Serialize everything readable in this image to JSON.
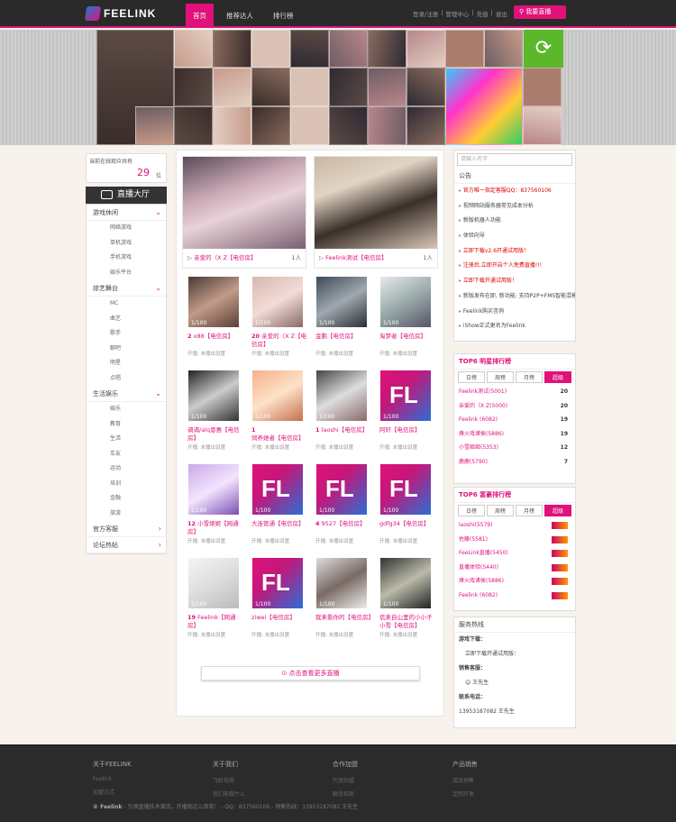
{
  "header": {
    "logo_text": "FEELINK",
    "nav": [
      "首页",
      "推荐达人",
      "排行榜"
    ],
    "top_links": [
      "登录/注册",
      "|",
      "管理中心",
      "|",
      "充值",
      "|",
      "退出"
    ],
    "live_button": "我要直播"
  },
  "sidebar": {
    "online_label": "当前在线观众共有",
    "online_count": "29",
    "online_unit": "位",
    "hall_label": "直播大厅",
    "categories": [
      {
        "label": "游戏休闲",
        "items": [
          "网络游戏",
          "单机游戏",
          "手机游戏",
          "娱乐平台"
        ]
      },
      {
        "label": "综艺舞台",
        "items": [
          "MC",
          "曲艺",
          "歌手",
          "聊吧",
          "明星",
          "点唱"
        ]
      },
      {
        "label": "生活娱乐",
        "items": [
          "娱乐",
          "教育",
          "生活",
          "车友",
          "运动",
          "培训",
          "金融",
          "旅游"
        ]
      },
      {
        "label": "官方客服",
        "items": []
      },
      {
        "label": "论坛热帖",
        "items": []
      }
    ]
  },
  "featured": [
    {
      "name": "亲爱的（X Z【电信房】",
      "count": "1人"
    },
    {
      "name": "Feelink测试【电信房】",
      "count": "1人"
    }
  ],
  "streams": [
    {
      "level": "2",
      "name": "x88【电信房】",
      "status": "开播: 未播出设置"
    },
    {
      "level": "20",
      "name": "亲爱的（X Z【电信房】",
      "status": "开播: 未播出设置"
    },
    {
      "level": "",
      "name": "金鹏【电信房】",
      "status": "开播: 未播出设置"
    },
    {
      "level": "",
      "name": "淘梦者【电信房】",
      "status": "开播: 未播出设置"
    },
    {
      "level": "",
      "name": "调调/alq恩惠【电信房】",
      "status": "开播: 未播出设置"
    },
    {
      "level": "1",
      "name": "饲养她者【电信房】",
      "status": "开播: 未播出设置"
    },
    {
      "level": "1",
      "name": "laoshi【电信房】",
      "status": "开播: 未播出设置"
    },
    {
      "level": "",
      "name": "阿轩【电信房】",
      "status": "开播: 未播出设置"
    },
    {
      "level": "12",
      "name": "小雪姬姬【网通房】",
      "status": "开播: 未播出设置"
    },
    {
      "level": "",
      "name": "大连管通【电信房】",
      "status": "开播: 未播出设置"
    },
    {
      "level": "4",
      "name": "9527【电信房】",
      "status": "开播: 未播出设置"
    },
    {
      "level": "",
      "name": "gdfg34【电信房】",
      "status": "开播: 未播出设置"
    },
    {
      "level": "19",
      "name": "Feelink【网通房】",
      "status": "开播: 未播出设置"
    },
    {
      "level": "",
      "name": "ziwei【电信房】",
      "status": "开播: 未播出设置"
    },
    {
      "level": "",
      "name": "我来看你的【电信房】",
      "status": "开播: 未播出设置"
    },
    {
      "level": "",
      "name": "佤来自山里的小小子小雪【电信房】",
      "status": "开播: 未播出设置"
    }
  ],
  "more_button": "点击查看更多直播",
  "right": {
    "search_placeholder": "请输入名字",
    "notice_title": "公告",
    "notices": [
      {
        "text": "官方唯一指定客服QQ：837560106",
        "red": true
      },
      {
        "text": "视频网站服务器常见成本分析",
        "red": false
      },
      {
        "text": "新版机器人功能",
        "red": false
      },
      {
        "text": "体验向导",
        "red": false
      },
      {
        "text": "立即下载v2.6开通试用版！",
        "red": true
      },
      {
        "text": "注册后,立即开启个人免费直播!!!",
        "red": true
      },
      {
        "text": "立即下载开通试用版！",
        "red": true
      },
      {
        "text": "新版发布在即, 新功能: 支持P2P+FMS智能混模式传输!!!",
        "red": false
      },
      {
        "text": "Feelink购买咨询",
        "red": false
      },
      {
        "text": "iShow正式更名为Feelink",
        "red": false
      }
    ],
    "rank1_title": "TOP6 明星排行榜",
    "rank2_title": "TOP6 富豪排行榜",
    "rank_tabs": [
      "日榜",
      "周榜",
      "月榜",
      "超级"
    ],
    "rank1": [
      {
        "name": "Feelink测试(5001)",
        "lv": "20"
      },
      {
        "name": "亲爱的（X Z(5000)",
        "lv": "20"
      },
      {
        "name": "Feelink (6082)",
        "lv": "19"
      },
      {
        "name": "烽火戏诸侯(5886)",
        "lv": "19"
      },
      {
        "name": "小雪姬姬(5353)",
        "lv": "12"
      },
      {
        "name": "鹿鹿(5790)",
        "lv": "7"
      }
    ],
    "rank2": [
      {
        "name": "laoshi(5579)"
      },
      {
        "name": "佐藤(5581)"
      },
      {
        "name": "FeeLink直播(5450)"
      },
      {
        "name": "直播体验(5440)"
      },
      {
        "name": "烽火戏诸侯(5886)"
      },
      {
        "name": "Feelink (6082)"
      }
    ],
    "service_title": "服务热线",
    "service": [
      "游戏下载：",
      "立即下载开通试用版：",
      "销售客服：",
      "王先生",
      "联系电话：",
      "13953187082 王先生"
    ]
  },
  "footer": {
    "cols": [
      {
        "h": "关于FEELINK",
        "l": [
          "Feelink",
          "加盟方式"
        ]
      },
      {
        "h": "关于我们",
        "l": [
          "飞聆视界",
          "我们能做什么"
        ]
      },
      {
        "h": "合作加盟",
        "l": [
          "代理加盟",
          "融资招商"
        ]
      },
      {
        "h": "产品销售",
        "l": [
          "成品销售",
          "定制开发"
        ]
      }
    ],
    "copyright_a": "© Feelink",
    "copyright_b": " - 引领直播技术潮流，开播就这么简单！ - QQ：837560106 - 销售热线：13953187082 王先生"
  }
}
